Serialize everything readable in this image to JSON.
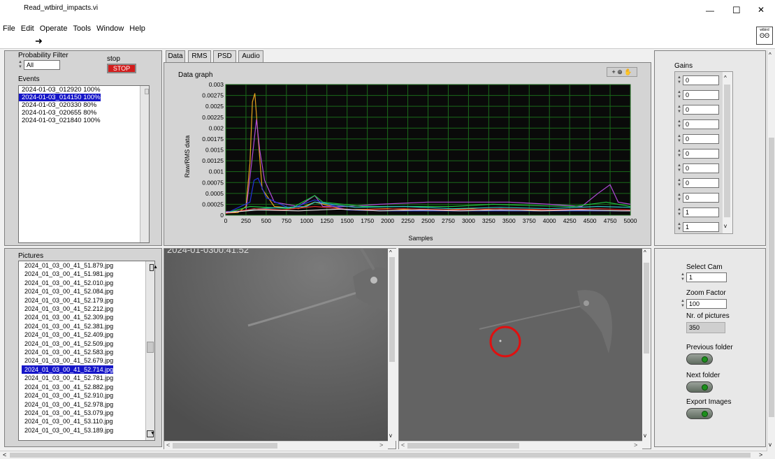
{
  "window": {
    "title": "Read_wtbird_impacts.vi",
    "minimize": "—",
    "maximize": "☐",
    "close": "✕",
    "lv_icon": "wtbird"
  },
  "menu": [
    "File",
    "Edit",
    "Operate",
    "Tools",
    "Window",
    "Help"
  ],
  "run_arrow": "➜",
  "filter": {
    "label": "Probability Filter",
    "value": "All"
  },
  "stop": {
    "label": "stop",
    "button": "STOP"
  },
  "events": {
    "label": "Events",
    "items": [
      "2024-01-03_012920 100%",
      "2024-01-03_014150 100%",
      "2024-01-03_020330 80%",
      "2024-01-03_020655 80%",
      "2024-01-03_021840 100%"
    ],
    "selected": 1
  },
  "tabs": [
    "Data",
    "RMS",
    "PSD",
    "Audio"
  ],
  "graph": {
    "label": "Data graph",
    "ylabel": "Raw/RMS data",
    "xlabel": "Samples"
  },
  "chart_data": {
    "type": "line",
    "title": "Data graph",
    "xlabel": "Samples",
    "ylabel": "Raw/RMS data",
    "xlim": [
      0,
      5000
    ],
    "ylim": [
      0,
      0.003
    ],
    "xticks": [
      "0",
      "250",
      "500",
      "750",
      "1000",
      "1250",
      "1500",
      "1750",
      "2000",
      "2250",
      "2500",
      "2750",
      "3000",
      "3250",
      "3500",
      "3750",
      "4000",
      "4250",
      "4500",
      "4750",
      "5000"
    ],
    "yticks": [
      "0",
      "0.00025",
      "0.0005",
      "0.00075",
      "0.001",
      "0.00125",
      "0.0015",
      "0.00175",
      "0.002",
      "0.00225",
      "0.0025",
      "0.00275",
      "0.003"
    ],
    "grid": true,
    "series": [
      {
        "color": "#e6a21e",
        "x": [
          0,
          150,
          250,
          300,
          330,
          360,
          400,
          450,
          600,
          900,
          1100,
          1500,
          2000,
          2500,
          3000,
          3500,
          4000,
          4500,
          5000
        ],
        "values": [
          5e-05,
          6e-05,
          0.0002,
          0.0012,
          0.0026,
          0.0028,
          0.0018,
          0.0006,
          0.0002,
          0.00015,
          0.0003,
          0.00012,
          0.00015,
          0.0001,
          0.00015,
          0.0001,
          0.00012,
          0.0001,
          0.0001
        ]
      },
      {
        "color": "#b04ad8",
        "x": [
          0,
          250,
          320,
          380,
          420,
          480,
          600,
          900,
          1100,
          1200,
          1500,
          1900,
          2500,
          3000,
          3500,
          4000,
          4400,
          4600,
          4750,
          4850,
          5000
        ],
        "values": [
          8e-05,
          0.0001,
          0.0012,
          0.0022,
          0.0015,
          0.0008,
          0.0003,
          0.0002,
          0.00045,
          0.0002,
          0.0002,
          0.00025,
          0.0003,
          0.0003,
          0.0003,
          0.00025,
          0.0002,
          0.0005,
          0.0007,
          0.0003,
          0.00025
        ]
      },
      {
        "color": "#2233dd",
        "x": [
          0,
          300,
          350,
          400,
          500,
          800,
          1100,
          1500,
          2000,
          3000,
          4000,
          5000
        ],
        "values": [
          4e-05,
          0.0003,
          0.0008,
          0.00085,
          0.0004,
          0.00015,
          0.00035,
          0.00012,
          0.0001,
          0.0001,
          0.0001,
          0.0001
        ]
      },
      {
        "color": "#20c040",
        "x": [
          0,
          300,
          800,
          1100,
          1200,
          1700,
          2200,
          2800,
          3300,
          3800,
          4300,
          4700,
          5000
        ],
        "values": [
          5e-05,
          0.0002,
          0.00015,
          0.00045,
          0.0003,
          0.0002,
          0.0002,
          0.0002,
          0.00025,
          0.00022,
          0.0002,
          0.0003,
          0.0002
        ]
      },
      {
        "color": "#30c0c0",
        "x": [
          0,
          400,
          1000,
          1100,
          1600,
          2200,
          2800,
          3400,
          4000,
          4600,
          5000
        ],
        "values": [
          5e-05,
          0.00015,
          0.0002,
          0.0003,
          0.00018,
          0.0002,
          0.00015,
          0.00018,
          0.00015,
          0.0002,
          0.00018
        ]
      },
      {
        "color": "#e03030",
        "x": [
          0,
          350,
          700,
          1100,
          1600,
          2200,
          2800,
          3400,
          4000,
          4600,
          5000
        ],
        "values": [
          4e-05,
          0.00015,
          0.00012,
          0.0002,
          0.00012,
          0.00015,
          0.00012,
          0.00015,
          0.00012,
          0.00015,
          0.00012
        ]
      },
      {
        "color": "#e8e8e8",
        "x": [
          0,
          400,
          900,
          1400,
          1900,
          2400,
          2900,
          3400,
          3900,
          4400,
          4900,
          5000
        ],
        "values": [
          6e-05,
          0.00012,
          0.0001,
          0.00014,
          0.0001,
          0.00012,
          0.0001,
          0.00012,
          0.0001,
          0.00012,
          0.0001,
          0.0001
        ]
      }
    ]
  },
  "gains": {
    "label": "Gains",
    "values": [
      "0",
      "0",
      "0",
      "0",
      "0",
      "0",
      "0",
      "0",
      "0",
      "1",
      "1"
    ]
  },
  "pictures": {
    "label": "Pictures",
    "items": [
      "2024_01_03_00_41_51.879.jpg",
      "2024_01_03_00_41_51.981.jpg",
      "2024_01_03_00_41_52.010.jpg",
      "2024_01_03_00_41_52.084.jpg",
      "2024_01_03_00_41_52.179.jpg",
      "2024_01_03_00_41_52.212.jpg",
      "2024_01_03_00_41_52.309.jpg",
      "2024_01_03_00_41_52.381.jpg",
      "2024_01_03_00_41_52.409.jpg",
      "2024_01_03_00_41_52.509.jpg",
      "2024_01_03_00_41_52.583.jpg",
      "2024_01_03_00_41_52.679.jpg",
      "2024_01_03_00_41_52.714.jpg",
      "2024_01_03_00_41_52.781.jpg",
      "2024_01_03_00_41_52.882.jpg",
      "2024_01_03_00_41_52.910.jpg",
      "2024_01_03_00_41_52.978.jpg",
      "2024_01_03_00_41_53.079.jpg",
      "2024_01_03_00_41_53.110.jpg",
      "2024_01_03_00_41_53.189.jpg"
    ],
    "selected": 12
  },
  "photo_stamp": "2024-01-0300:41:52",
  "controls": {
    "select_cam": {
      "label": "Select Cam",
      "value": "1"
    },
    "zoom": {
      "label": "Zoom Factor",
      "value": "100"
    },
    "nr_pictures": {
      "label": "Nr. of pictures",
      "value": "350"
    },
    "prev_folder": "Previous folder",
    "next_folder": "Next folder",
    "export": "Export Images"
  },
  "colors": {
    "highlight": "#1515c8",
    "stop": "#d21c1c",
    "plot_bg": "#0a0a0a",
    "grid": "#1a6a1a",
    "marker": "#e01010"
  }
}
